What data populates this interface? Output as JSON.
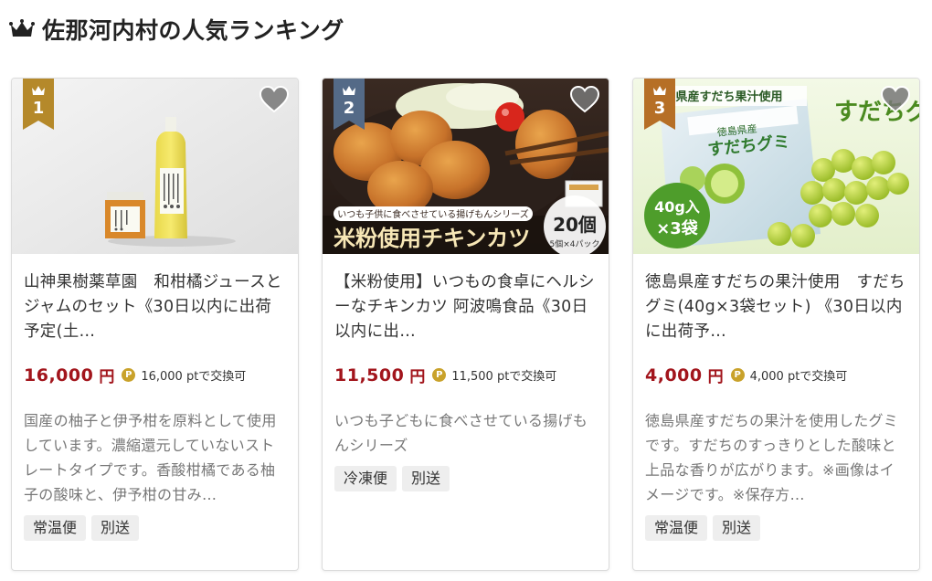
{
  "section": {
    "title": "佐那河内村の人気ランキング",
    "icon": "crown-icon"
  },
  "colors": {
    "price": "#a2151c",
    "rank1": "#b5892a",
    "rank2": "#546a87",
    "rank3": "#b66f26",
    "point": "#c9a22b"
  },
  "cards": [
    {
      "rank": "1",
      "title": "山神果樹薬草園　和柑橘ジュースとジャムのセット《30日以内に出荷予定(土…",
      "price": "16,000",
      "price_unit": "円",
      "point_icon": "P",
      "points": "16,000 ptで交換可",
      "description": "国産の柚子と伊予柑を原料として使用しています。濃縮還元していないストレートタイプです。香酸柑橘である柚子の酸味と、伊予柑の甘み…",
      "tags": [
        "常温便",
        "別送"
      ]
    },
    {
      "rank": "2",
      "title": "【米粉使用】いつもの食卓にヘルシーなチキンカツ 阿波鳴食品《30日以内に出…",
      "price": "11,500",
      "price_unit": "円",
      "point_icon": "P",
      "points": "11,500 ptで交換可",
      "description": "いつも子どもに食べさせている揚げもんシリーズ",
      "tags": [
        "冷凍便",
        "別送"
      ],
      "image_text": {
        "banner": "いつも子供に食べさせている揚げもんシリーズ",
        "headline": "米粉使用チキンカツ",
        "count": "20個",
        "count_sub": "5個×4パック"
      }
    },
    {
      "rank": "3",
      "title": "徳島県産すだちの果汁使用　すだちグミ(40g×3袋セット) 《30日以内に出荷予…",
      "price": "4,000",
      "price_unit": "円",
      "point_icon": "P",
      "points": "4,000 ptで交換可",
      "description": "徳島県産すだちの果汁を使用したグミです。すだちのすっきりとした酸味と上品な香りが広がります。※画像はイメージです。※保存方…",
      "tags": [
        "常温便",
        "別送"
      ],
      "image_text": {
        "banner": "県産すだち果汁使用",
        "headline": "すだちグミ",
        "bag_label": "すだちグミ",
        "bag_sub": "徳島県産",
        "qty": "40g入",
        "qty2": "×3袋"
      }
    }
  ]
}
